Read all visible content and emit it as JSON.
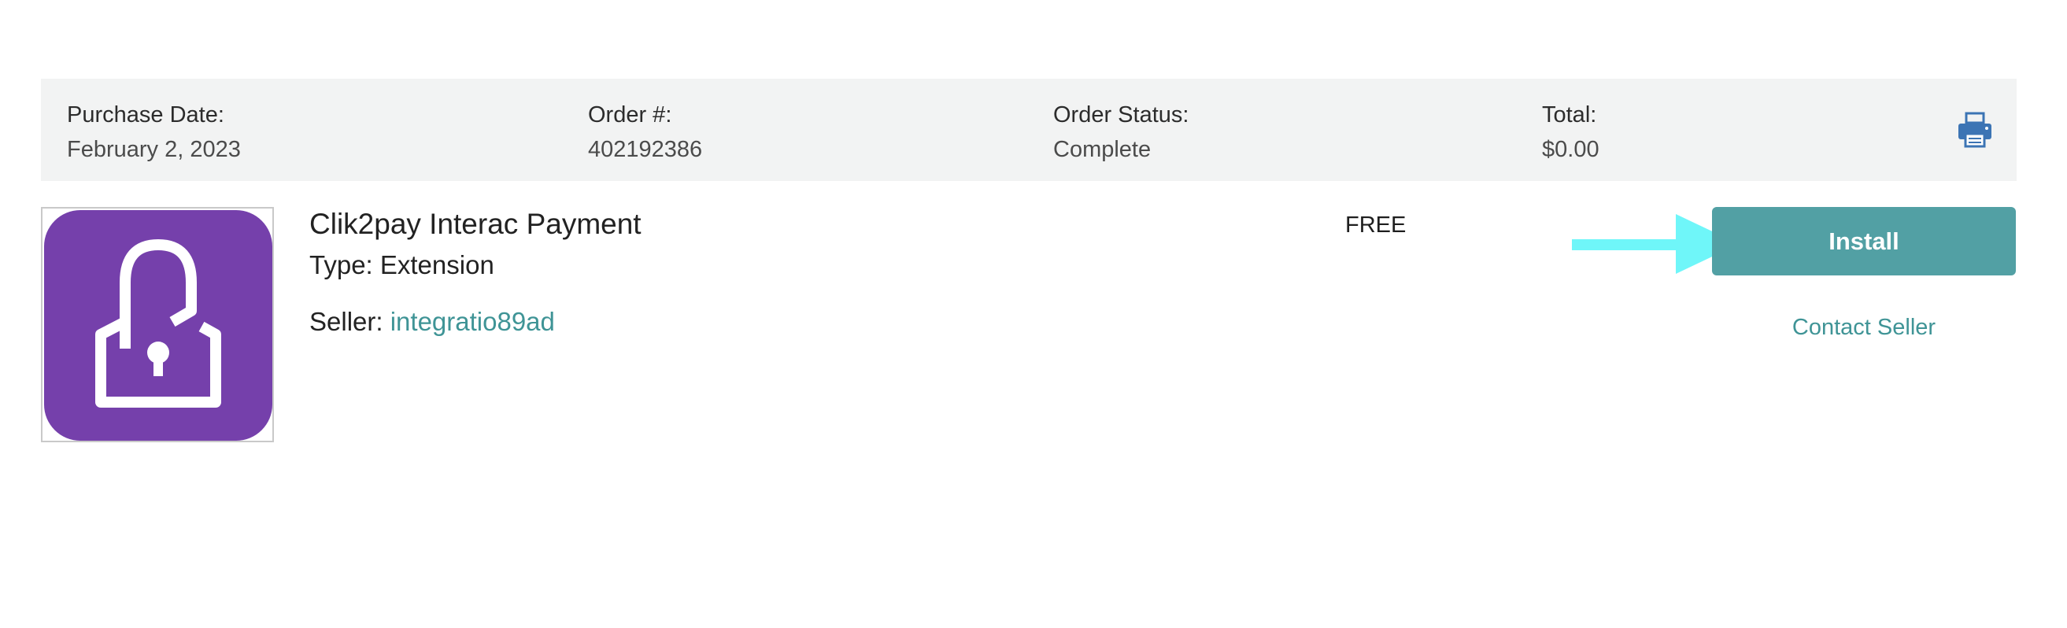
{
  "order": {
    "purchase_date_label": "Purchase Date:",
    "purchase_date_value": "February 2, 2023",
    "order_number_label": "Order #:",
    "order_number_value": "402192386",
    "status_label": "Order Status:",
    "status_value": "Complete",
    "total_label": "Total:",
    "total_value": "$0.00",
    "print_icon": "printer-icon"
  },
  "product": {
    "name": "Clik2pay Interac Payment",
    "type_text": "Type: Extension",
    "seller_label": "Seller: ",
    "seller_name": "integratio89ad",
    "price": "FREE",
    "thumbnail_icon": "lock-person-icon",
    "thumbnail_color": "#7540ab"
  },
  "actions": {
    "install_label": "Install",
    "contact_seller_label": "Contact Seller"
  },
  "colors": {
    "accent": "#52a0a4",
    "link": "#3f9496",
    "header_bg": "#f2f3f3",
    "annotation_arrow": "#6ff6f9"
  }
}
